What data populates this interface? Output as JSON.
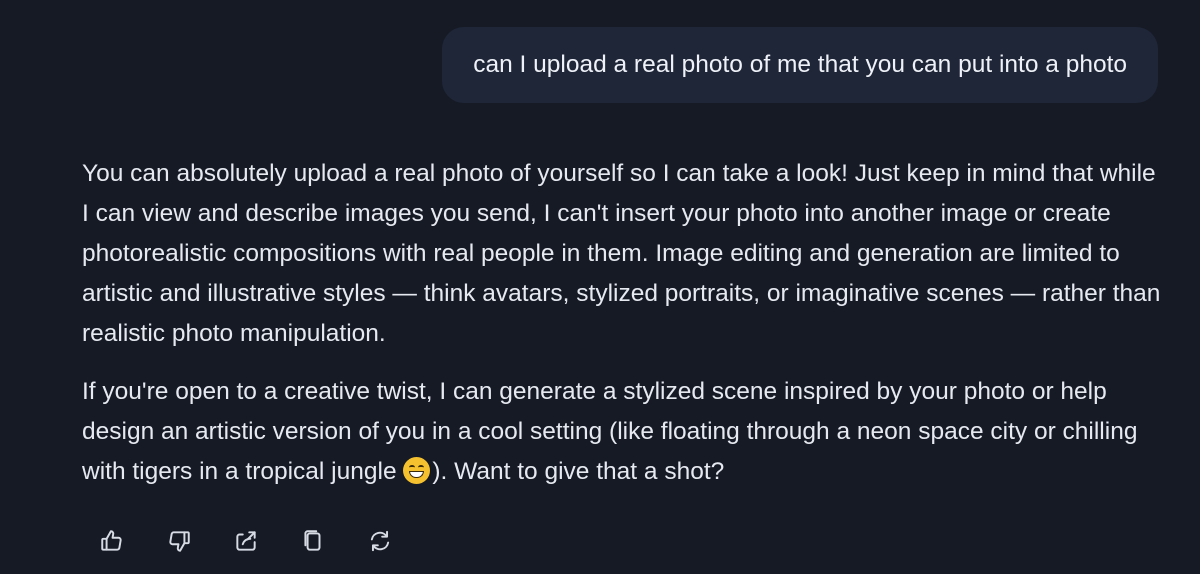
{
  "user_message": {
    "text": "can I upload a real photo of me that you can put into a photo"
  },
  "assistant_message": {
    "paragraph_1": "You can absolutely upload a real photo of yourself so I can take a look! Just keep in mind that while I can view and describe images you send, I can't insert your photo into another image or create photorealistic compositions with real people in them. Image editing and generation are limited to artistic and illustrative styles — think avatars, stylized portraits, or imaginative scenes — rather than realistic photo manipulation.",
    "paragraph_2_before_emoji": "If you're open to a creative twist, I can generate a stylized scene inspired by your photo or help design an artistic version of you in a cool setting (like floating through a neon space city or chilling with tigers in a tropical jungle ",
    "paragraph_2_emoji": "grinning-face-emoji",
    "paragraph_2_after_emoji": "). Want to give that a shot?"
  },
  "actions": [
    {
      "name": "like",
      "icon": "thumbs-up-icon"
    },
    {
      "name": "dislike",
      "icon": "thumbs-down-icon"
    },
    {
      "name": "share",
      "icon": "share-icon"
    },
    {
      "name": "copy",
      "icon": "copy-icon"
    },
    {
      "name": "regenerate",
      "icon": "refresh-icon"
    }
  ],
  "colors": {
    "background": "#161a25",
    "user_bubble": "#1f2638",
    "text": "#e6e9f0",
    "icon": "#d7dbe4"
  }
}
